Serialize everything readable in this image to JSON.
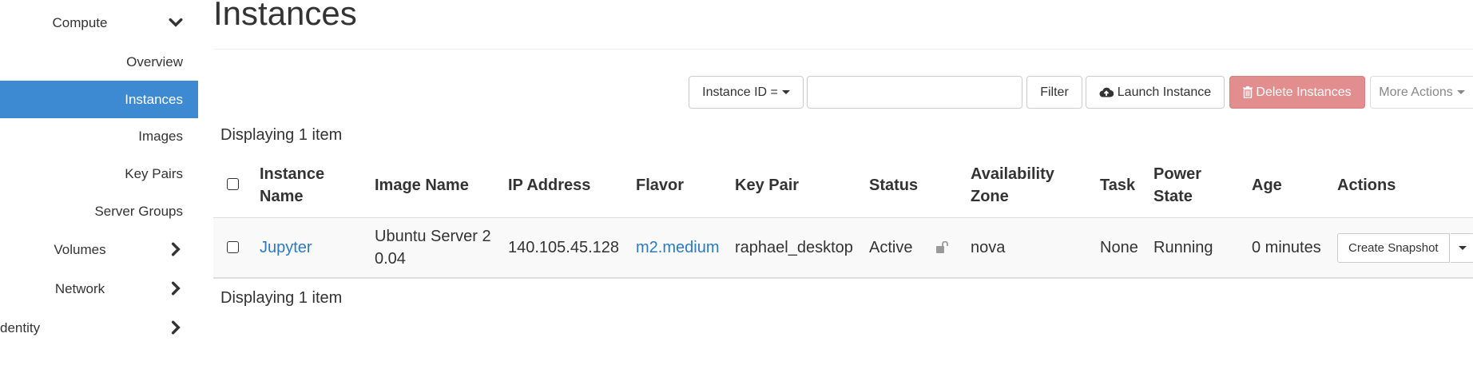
{
  "sidebar": {
    "compute": {
      "label": "Compute"
    },
    "items": [
      {
        "label": "Overview"
      },
      {
        "label": "Instances",
        "active": true
      },
      {
        "label": "Images"
      },
      {
        "label": "Key Pairs"
      },
      {
        "label": "Server Groups"
      }
    ],
    "volumes": {
      "label": "Volumes"
    },
    "network": {
      "label": "Network"
    },
    "identity": {
      "label": "dentity"
    }
  },
  "page": {
    "title": "Instances"
  },
  "toolbar": {
    "filter_field": "Instance ID =",
    "search_value": "",
    "search_placeholder": "",
    "filter_label": "Filter",
    "launch_label": "Launch Instance",
    "delete_label": "Delete Instances",
    "more_label": "More Actions"
  },
  "display_count_top": "Displaying 1 item",
  "display_count_bottom": "Displaying 1 item",
  "table": {
    "headers": {
      "name_1": "Instance",
      "name_2": "Name",
      "image": "Image Name",
      "ip": "IP Address",
      "flavor": "Flavor",
      "keypair": "Key Pair",
      "status": "Status",
      "az_1": "Availability",
      "az_2": "Zone",
      "task": "Task",
      "power_1": "Power",
      "power_2": "State",
      "age": "Age",
      "actions": "Actions"
    },
    "rows": [
      {
        "name": "Jupyter",
        "image_1": "Ubuntu Server 2",
        "image_2": "0.04",
        "ip": "140.105.45.128",
        "flavor": "m2.medium",
        "keypair": "raphael_desktop",
        "status": "Active",
        "lock_icon": "unlocked-icon",
        "az": "nova",
        "task": "None",
        "power": "Running",
        "age": "0 minutes",
        "action_label": "Create Snapshot"
      }
    ]
  },
  "colors": {
    "accent": "#3d8ad2",
    "link": "#2a7ac4",
    "danger": "#e38e8e"
  }
}
